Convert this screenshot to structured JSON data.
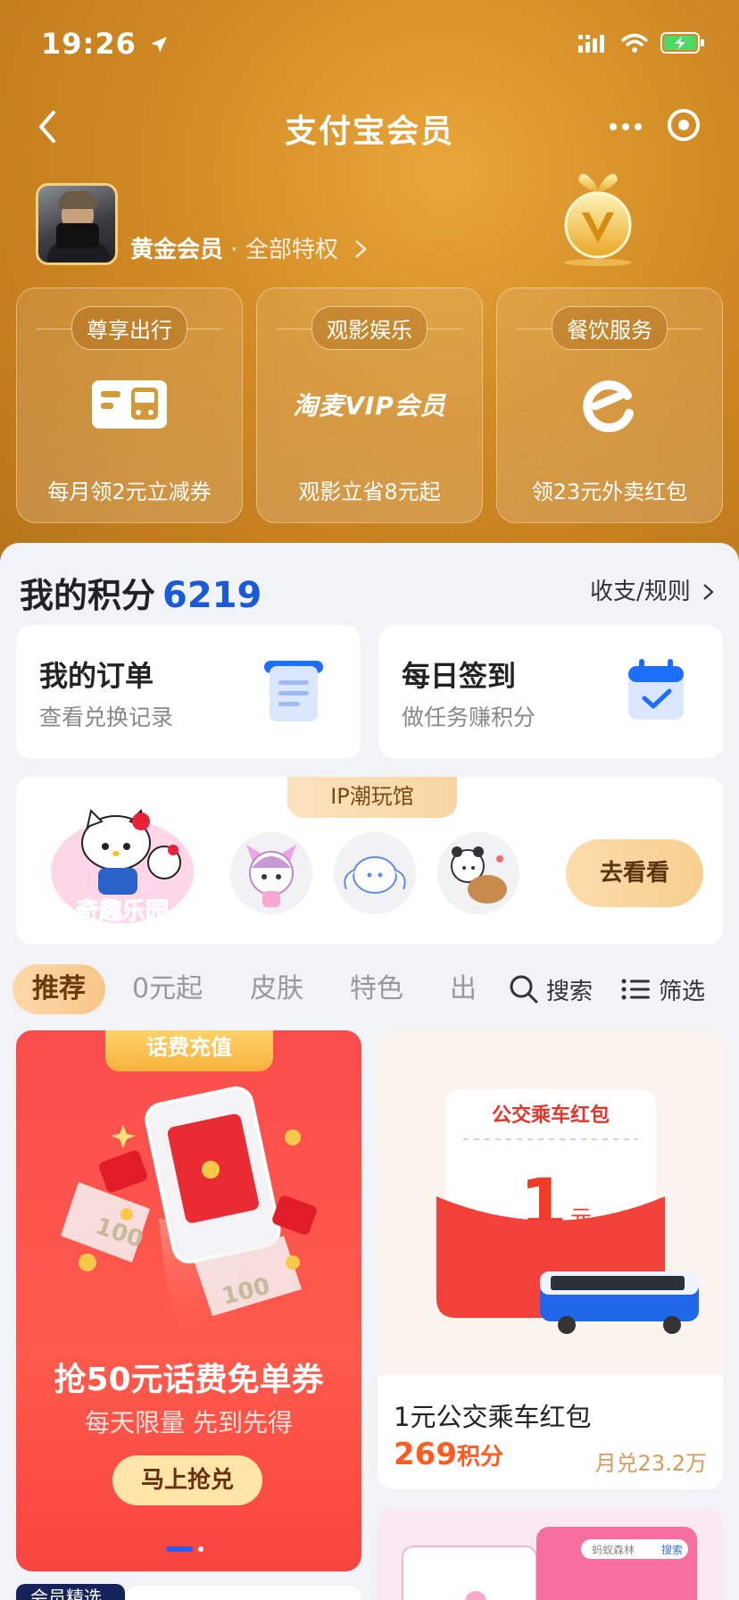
{
  "status_bar": {
    "time": "19:26"
  },
  "navbar": {
    "title": "支付宝会员"
  },
  "member": {
    "level": "黄金会员",
    "separator": " · ",
    "privileges": "全部特权"
  },
  "benefits": [
    {
      "tag": "尊享出行",
      "text": "每月领2元立减券",
      "icon": "bus-ticket-icon"
    },
    {
      "tag": "观影娱乐",
      "text": "观影立省8元起",
      "logo": "淘麦VIP会员"
    },
    {
      "tag": "餐饮服务",
      "text": "领23元外卖红包",
      "icon": "eleme-icon"
    }
  ],
  "points": {
    "label": "我的积分",
    "value": "6219",
    "rules_label": "收支/规则"
  },
  "quick_cards": [
    {
      "title": "我的订单",
      "subtitle": "查看兑换记录"
    },
    {
      "title": "每日签到",
      "subtitle": "做任务赚积分"
    }
  ],
  "ip": {
    "tag": "IP潮玩馆",
    "brand": "奇趣乐园",
    "button": "去看看"
  },
  "tabs": {
    "items": [
      "推荐",
      "0元起",
      "皮肤",
      "特色",
      "出"
    ],
    "active": "推荐",
    "search_label": "搜索",
    "filter_label": "筛选"
  },
  "promo": {
    "tag": "话费充值",
    "title": "抢50元话费免单券",
    "subtitle": "每天限量 先到先得",
    "button": "马上抢兑",
    "coupon_value": "100"
  },
  "product": {
    "header": "公交乘车红包",
    "amount": "1",
    "unit": "元",
    "name": "1元公交乘车红包",
    "price": "269",
    "price_unit": "积分",
    "sold": "月兑23.2万"
  },
  "bottom": {
    "badge": "会员精选",
    "shop_label": "蚂蚁森林",
    "search_label": "搜索"
  },
  "colors": {
    "accent_blue": "#1a5ad8",
    "price_orange": "#ff5a1f",
    "gold": "#d18a24",
    "promo_red": "#fa4d4d"
  }
}
